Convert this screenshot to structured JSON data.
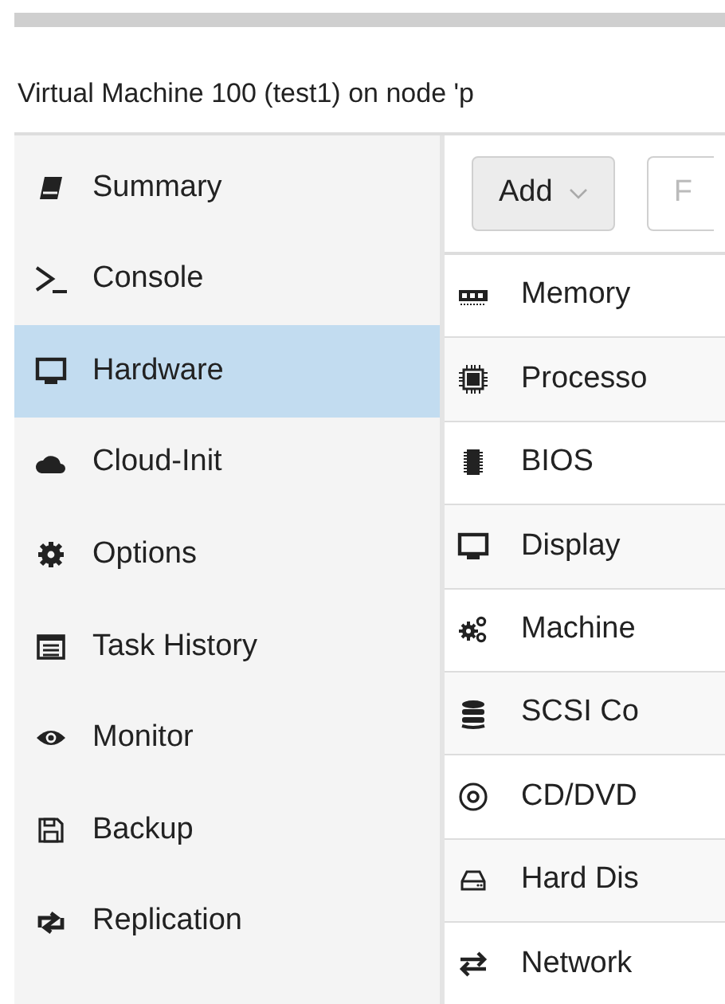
{
  "title": "Virtual Machine 100 (test1) on node 'p",
  "nav": [
    {
      "label": "Summary",
      "selected": false
    },
    {
      "label": "Console",
      "selected": false
    },
    {
      "label": "Hardware",
      "selected": true
    },
    {
      "label": "Cloud-Init",
      "selected": false
    },
    {
      "label": "Options",
      "selected": false
    },
    {
      "label": "Task History",
      "selected": false
    },
    {
      "label": "Monitor",
      "selected": false
    },
    {
      "label": "Backup",
      "selected": false
    },
    {
      "label": "Replication",
      "selected": false
    }
  ],
  "toolbar": [
    {
      "label": "Add",
      "kind": "menu"
    },
    {
      "label": "F",
      "kind": "plain"
    }
  ],
  "hardware": [
    {
      "label": "Memory"
    },
    {
      "label": "Processo"
    },
    {
      "label": "BIOS"
    },
    {
      "label": "Display"
    },
    {
      "label": "Machine"
    },
    {
      "label": "SCSI Co"
    },
    {
      "label": "CD/DVD"
    },
    {
      "label": "Hard Dis"
    },
    {
      "label": "Network"
    }
  ]
}
